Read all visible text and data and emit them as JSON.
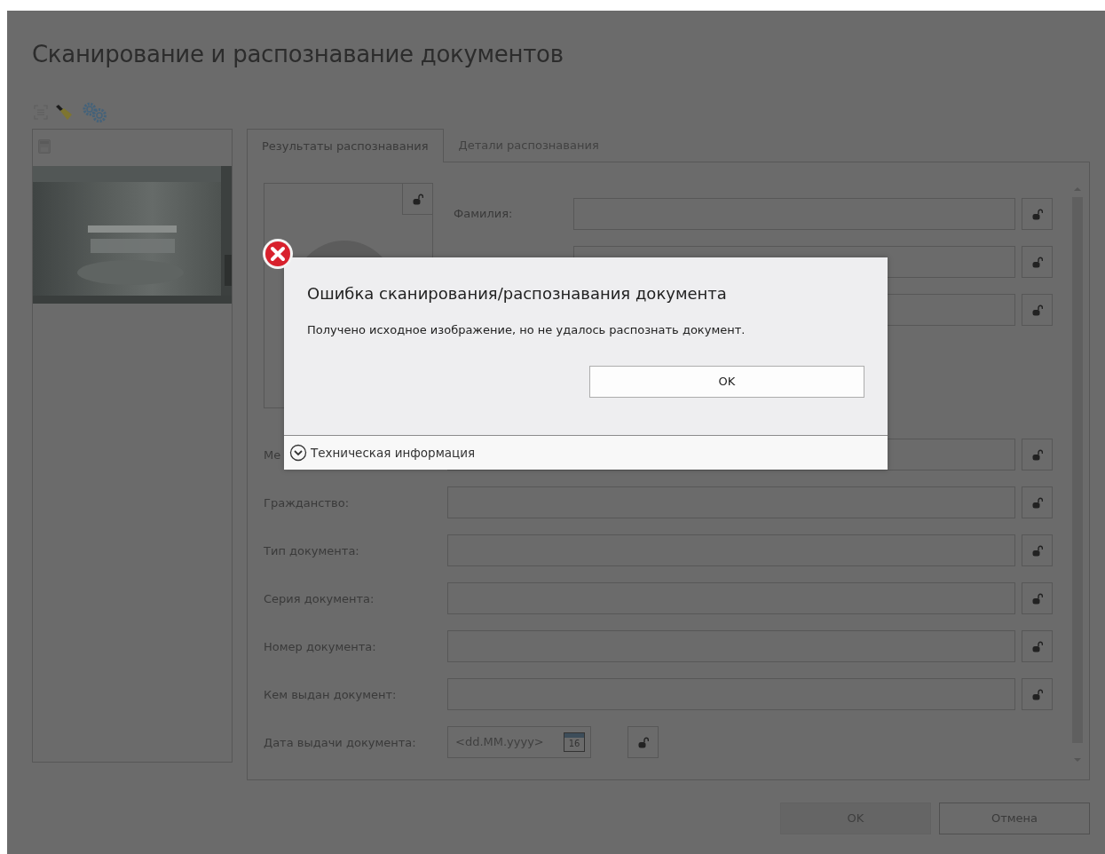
{
  "window": {
    "title": "Сканирование и распознавание документов"
  },
  "tabs": [
    {
      "label": "Результаты распознавания",
      "selected": true
    },
    {
      "label": "Детали распознавания",
      "selected": false
    }
  ],
  "name_fields": [
    {
      "kind": "text",
      "label": "Фамилия:"
    },
    {
      "kind": "text"
    },
    {
      "kind": "text"
    }
  ],
  "fields": [
    {
      "kind": "text",
      "label": "Ме"
    },
    {
      "kind": "text",
      "label": "Гражданство:"
    },
    {
      "kind": "text",
      "label": "Тип документа:"
    },
    {
      "kind": "text",
      "label": "Серия документа:"
    },
    {
      "kind": "text",
      "label": "Номер документа:"
    },
    {
      "kind": "text",
      "label": "Кем выдан документ:"
    },
    {
      "kind": "date",
      "label": "Дата выдачи документа:",
      "placeholder": "<dd.MM.yyyy>",
      "calendar_day": "16"
    }
  ],
  "dialog": {
    "title": "Ошибка сканирования/распознавания документа",
    "message": "Получено исходное изображение, но не удалось распознать документ.",
    "button": "OK",
    "details": "Техническая информация",
    "expanded": false
  },
  "buttons": [
    {
      "label": "OK",
      "disabled": true
    },
    {
      "label": "Отмена",
      "disabled": false
    }
  ]
}
